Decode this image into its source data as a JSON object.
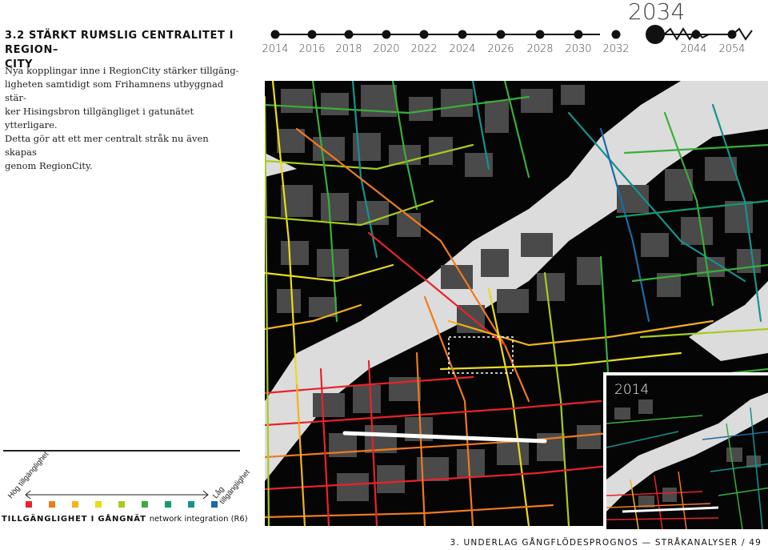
{
  "section": {
    "number": "3.2",
    "title": "STÄRKT RUMSLIG CENTRALITET I REGIONCITY",
    "title_line1": "3.2 STÄRKT RUMSLIG CENTRALITET I REGION–",
    "title_line2": "CITY"
  },
  "intro": {
    "lines": [
      "Nya kopplingar inne i RegionCity stärker tillgäng-",
      "ligheten samtidigt som Frihamnens utbyggnad stär-",
      "ker Hisingsbron tillgängliget i gatunätet ytterligare.",
      "Detta gör att ett mer centralt stråk nu även skapas",
      "genom RegionCity."
    ]
  },
  "timeline": {
    "current_year": "2034",
    "years": [
      "2014",
      "2016",
      "2018",
      "2020",
      "2022",
      "2024",
      "2026",
      "2028",
      "2030",
      "2032",
      "2044",
      "2054"
    ]
  },
  "map": {
    "inset_year": "2014"
  },
  "legend": {
    "high_label": "Hög tillgänglighet",
    "low_label": "Låg tillgänglighet",
    "title_bold": "TILLGÄNGLIGHET I GÅNGNÄT",
    "title_sub": "network integration (R6)",
    "colors": [
      "#e8232a",
      "#f07a1e",
      "#f4b21c",
      "#e8dc1c",
      "#a6cc1e",
      "#3aae3a",
      "#169a6a",
      "#16928e",
      "#1a6aa6",
      "#1a3a78"
    ]
  },
  "footer": {
    "text": "3. UNDERLAG GÅNGFLÖDESPROGNOS — STRÅKANALYSER / 49"
  }
}
